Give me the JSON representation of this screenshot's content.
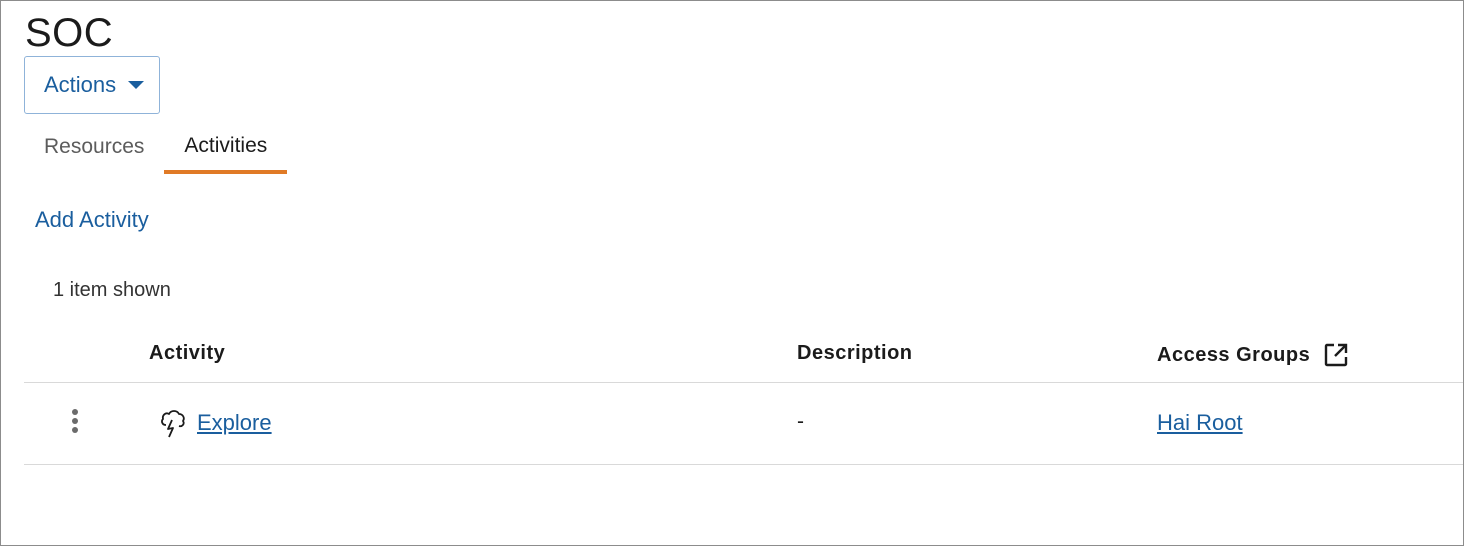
{
  "page": {
    "title": "SOC"
  },
  "actions": {
    "label": "Actions"
  },
  "tabs": [
    {
      "label": "Resources",
      "active": false
    },
    {
      "label": "Activities",
      "active": true
    }
  ],
  "add_activity": {
    "label": "Add Activity"
  },
  "list": {
    "count_text": "1 item shown"
  },
  "table": {
    "columns": [
      "Activity",
      "Description",
      "Access Groups"
    ],
    "rows": [
      {
        "activity": "Explore",
        "activity_icon": "explore-icon",
        "description": "-",
        "access_group": "Hai Root"
      }
    ]
  },
  "colors": {
    "accent": "#1a5e9e",
    "active_tab_underline": "#e07a26"
  }
}
